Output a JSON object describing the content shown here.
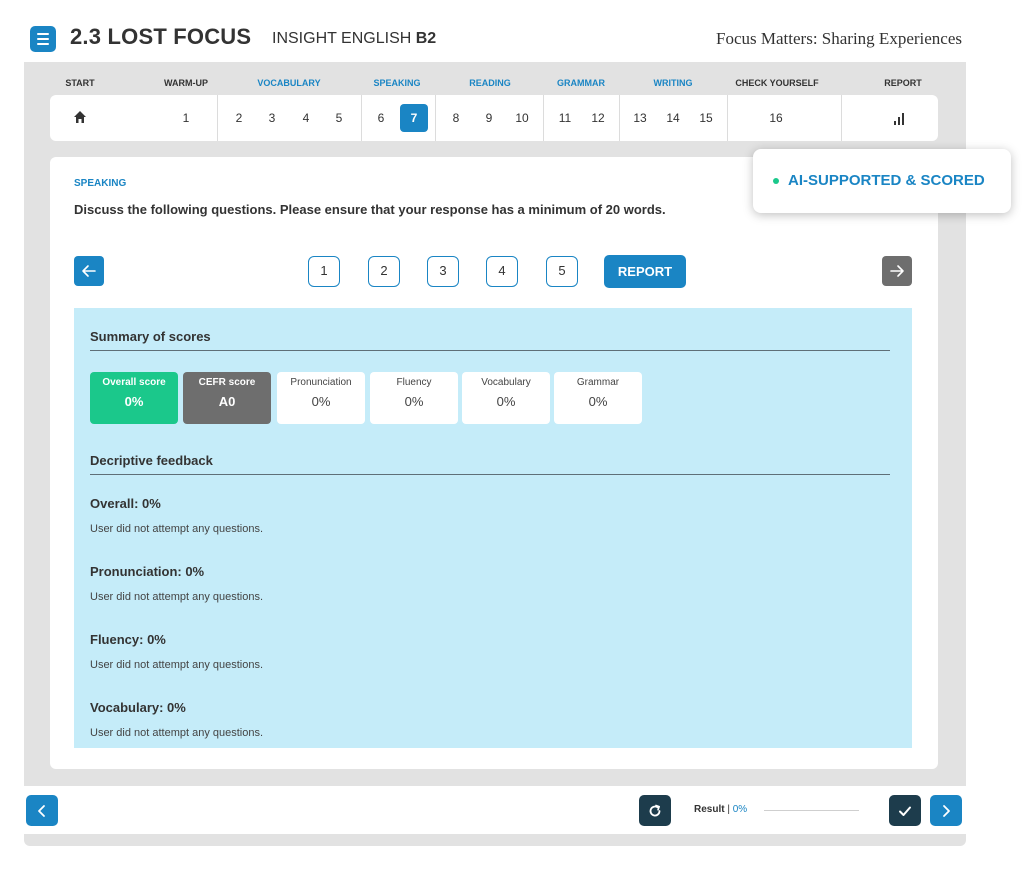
{
  "header": {
    "title": "2.3 LOST FOCUS",
    "course_prefix": "INSIGHT ENGLISH",
    "course_level": "B2",
    "lesson_name": "Focus Matters: Sharing Experiences"
  },
  "nav": {
    "sections": [
      {
        "label": "START",
        "style": "dark"
      },
      {
        "label": "WARM-UP",
        "style": "dark"
      },
      {
        "label": "VOCABULARY",
        "style": "blue"
      },
      {
        "label": "SPEAKING",
        "style": "blue"
      },
      {
        "label": "READING",
        "style": "blue"
      },
      {
        "label": "GRAMMAR",
        "style": "blue"
      },
      {
        "label": "WRITING",
        "style": "blue"
      },
      {
        "label": "CHECK YOURSELF",
        "style": "dark"
      },
      {
        "label": "REPORT",
        "style": "dark"
      }
    ],
    "pages": [
      "1",
      "2",
      "3",
      "4",
      "5",
      "6",
      "7",
      "8",
      "9",
      "10",
      "11",
      "12",
      "13",
      "14",
      "15",
      "16"
    ],
    "active_page": "7",
    "home_icon": "home-icon",
    "report_icon": "bar-chart-icon"
  },
  "activity": {
    "section_label": "SPEAKING",
    "instruction": "Discuss the following questions. Please ensure that your response has a minimum of 20 words.",
    "ai_badge": "AI-SUPPORTED & SCORED",
    "question_buttons": [
      "1",
      "2",
      "3",
      "4",
      "5"
    ],
    "report_button": "REPORT",
    "prev_icon": "arrow-left-icon",
    "next_icon": "arrow-right-icon"
  },
  "summary": {
    "heading": "Summary of scores",
    "tiles": [
      {
        "label": "Overall score",
        "value": "0%",
        "style": "green"
      },
      {
        "label": "CEFR score",
        "value": "A0",
        "style": "grey"
      },
      {
        "label": "Pronunciation",
        "value": "0%",
        "style": "white"
      },
      {
        "label": "Fluency",
        "value": "0%",
        "style": "white"
      },
      {
        "label": "Vocabulary",
        "value": "0%",
        "style": "white"
      },
      {
        "label": "Grammar",
        "value": "0%",
        "style": "white"
      }
    ]
  },
  "feedback": {
    "heading": "Decriptive feedback",
    "items": [
      {
        "title": "Overall: 0%",
        "text": "User did not attempt any questions."
      },
      {
        "title": "Pronunciation: 0%",
        "text": "User did not attempt any questions."
      },
      {
        "title": "Fluency: 0%",
        "text": "User did not attempt any questions."
      },
      {
        "title": "Vocabulary: 0%",
        "text": "User did not attempt any questions."
      }
    ]
  },
  "footer": {
    "result_label": "Result",
    "result_separator": "|",
    "result_value": "0%",
    "result_progress": 0,
    "prev_icon": "chevron-left-icon",
    "reset_icon": "refresh-icon",
    "check_icon": "check-icon",
    "next_icon": "chevron-right-icon"
  },
  "colors": {
    "accent": "#1a85c4",
    "success": "#1bc88b",
    "panel": "#c5ecf9",
    "dark": "#1d3c4c"
  }
}
